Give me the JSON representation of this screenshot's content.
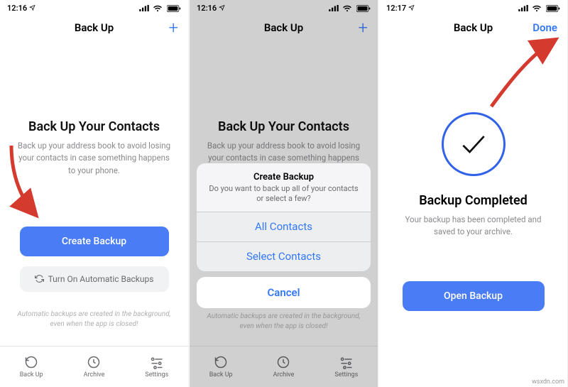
{
  "watermark": "wsxdn.com",
  "screen1": {
    "time": "12:16",
    "nav_title": "Back Up",
    "heading": "Back Up Your Contacts",
    "sub": "Back up your address book to avoid losing your contacts in case something happens to your phone.",
    "primary_btn": "Create Backup",
    "secondary_btn": "Turn On Automatic Backups",
    "hint": "Automatic backups are created in the background, even when the app is closed!",
    "tabs": {
      "backup": "Back Up",
      "archive": "Archive",
      "settings": "Settings"
    }
  },
  "screen2": {
    "time": "12:16",
    "nav_title": "Back Up",
    "heading": "Back Up Your Contacts",
    "sub": "Back up your address book to avoid losing your contacts in case something happens to your phone.",
    "hint": "Automatic backups are created in the background, even when the app is closed!",
    "sheet": {
      "title": "Create Backup",
      "message": "Do you want to back up all of your contacts or select a few?",
      "opt1": "All Contacts",
      "opt2": "Select Contacts",
      "cancel": "Cancel"
    },
    "tabs": {
      "backup": "Back Up",
      "archive": "Archive",
      "settings": "Settings"
    }
  },
  "screen3": {
    "time": "12:17",
    "nav_title": "Back Up",
    "done": "Done",
    "heading": "Backup Completed",
    "sub": "Your backup has been completed and saved to your archive.",
    "open_btn": "Open Backup"
  }
}
